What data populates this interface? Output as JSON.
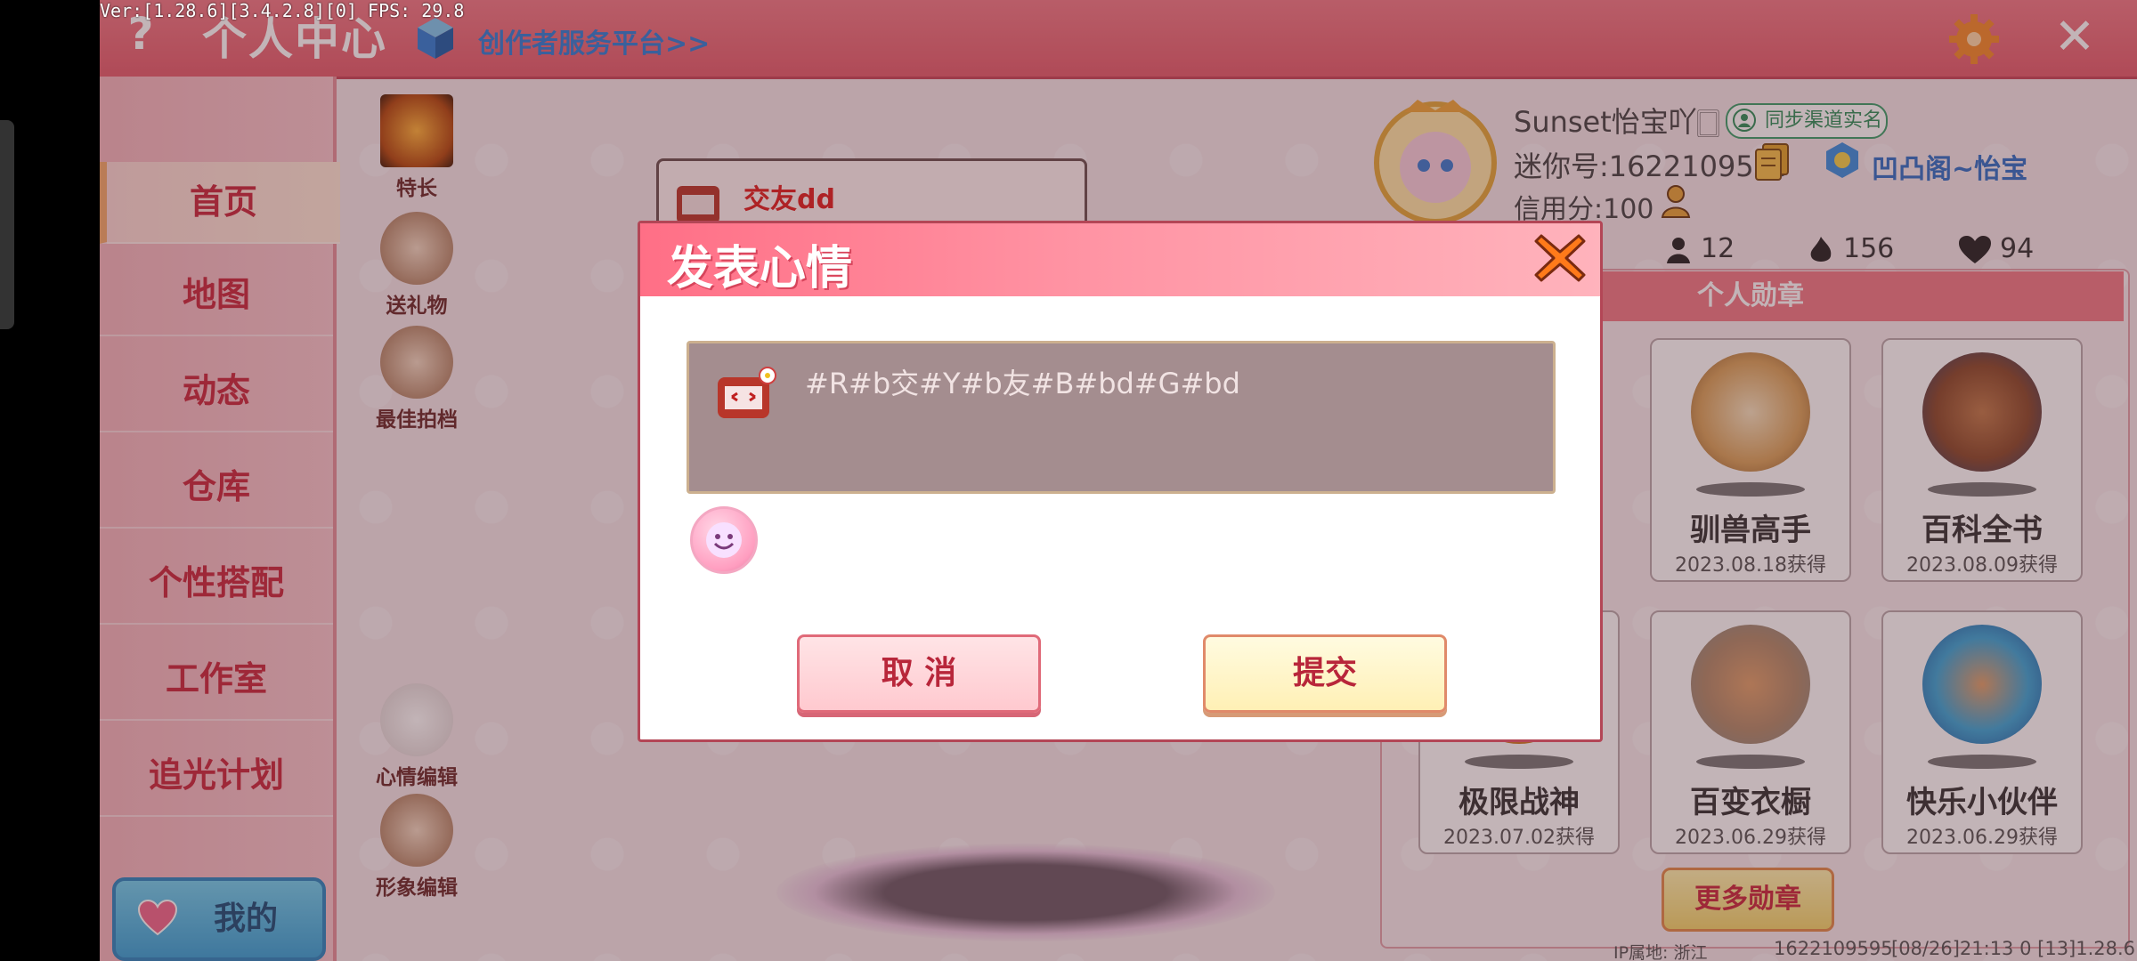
{
  "debug": {
    "version_text": "Ver:[1.28.6][3.4.2.8][0] FPS: 29.8"
  },
  "header": {
    "title": "个人中心",
    "creator_link": "创作者服务平台>>",
    "help_glyph": "?",
    "close_glyph": "✕"
  },
  "sidebar": {
    "items": [
      {
        "label": "首页"
      },
      {
        "label": "地图"
      },
      {
        "label": "动态"
      },
      {
        "label": "仓库"
      },
      {
        "label": "个性搭配"
      },
      {
        "label": "工作室"
      },
      {
        "label": "追光计划"
      }
    ],
    "mine_label": "我的"
  },
  "quick_actions": [
    {
      "label": "特长"
    },
    {
      "label": "送礼物"
    },
    {
      "label": "最佳拍档"
    },
    {
      "label": "心情编辑"
    },
    {
      "label": "形象编辑"
    }
  ],
  "mood_card": {
    "text": "交友dd"
  },
  "profile": {
    "username": "Sunset怡宝吖🀆",
    "realname_badge": "同步渠道实名",
    "mini_id": "迷你号:1622109595",
    "team_name": "凹凸阁~怡宝",
    "credit": "信用分:100",
    "stats": [
      {
        "icon": "fans-icon",
        "value": "12"
      },
      {
        "icon": "fire-icon",
        "value": "156"
      },
      {
        "icon": "like-icon",
        "value": "94"
      }
    ]
  },
  "badges": {
    "header": "个人勋章",
    "items": [
      {
        "name": "驯兽高手",
        "date": "2023.08.18获得"
      },
      {
        "name": "百科全书",
        "date": "2023.08.09获得"
      },
      {
        "name": "极限战神",
        "date": "2023.07.02获得"
      },
      {
        "name": "百变衣橱",
        "date": "2023.06.29获得"
      },
      {
        "name": "快乐小伙伴",
        "date": "2023.06.29获得"
      }
    ],
    "more_label": "更多勋章"
  },
  "footer": {
    "ip": "IP属地: 浙江",
    "id": "1622109595",
    "time": "[08/26]21:13 0 [13]1.28.6"
  },
  "dialog": {
    "title": "发表心情",
    "input_value": "#R#b交#Y#b友#B#bd#G#bd",
    "cancel_label": "取 消",
    "submit_label": "提交"
  },
  "colors": {
    "header_pink": "#f07a86",
    "sidebar_text": "#c8283c",
    "creator_link": "#2f7fd6",
    "cancel_bg": "#ffc9cf",
    "submit_bg": "#fff0b5"
  }
}
